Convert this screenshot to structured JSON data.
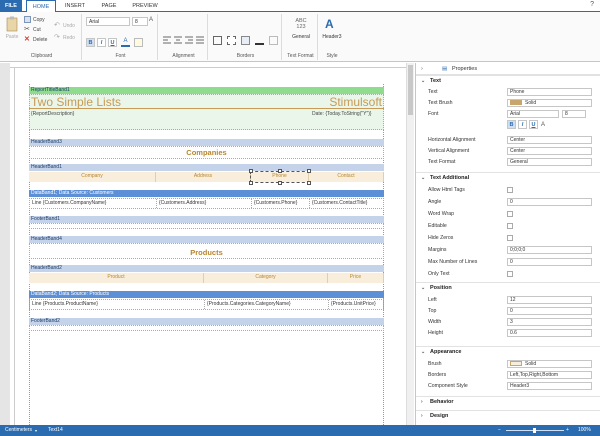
{
  "tabs": {
    "file": "FILE",
    "home": "HOME",
    "insert": "INSERT",
    "page": "PAGE",
    "preview": "PREVIEW",
    "help": "?"
  },
  "ribbon": {
    "clipboard": {
      "paste": "Paste",
      "copy": "Copy",
      "cut": "Cut",
      "delete": "Delete",
      "undo": "Undo",
      "redo": "Redo",
      "label": "Clipboard"
    },
    "font": {
      "name": "Arial",
      "size": "8",
      "label": "Font",
      "bold": "B",
      "italic": "I",
      "underline": "U"
    },
    "alignment": {
      "label": "Alignment"
    },
    "borders": {
      "label": "Borders"
    },
    "text_format": {
      "preview": "ABC\n123",
      "name": "General",
      "label": "Text Format"
    },
    "style": {
      "preview": "A",
      "name": "Header3",
      "label": "Style"
    }
  },
  "report": {
    "report_title_band": "ReportTitleBand1",
    "title": "Two Simple Lists",
    "brand": "Stimulsoft",
    "description": "{ReportDescription}",
    "date_expr": "Date: {Today.ToString(\"Y\")}",
    "header_band3": "HeaderBand3",
    "companies_title": "Companies",
    "header_band1": "HeaderBand1",
    "company_cols": [
      "Company",
      "Address",
      "Phone",
      "Contact"
    ],
    "data_band1": "DataBand1; Data Source: Customers",
    "company_cells": [
      "Line {Customers.CompanyName}",
      "{Customers.Address}",
      "{Customers.Phone}",
      "{Customers.ContactTitle}"
    ],
    "footer_band1": "FooterBand1",
    "header_band4": "HeaderBand4",
    "products_title": "Products",
    "header_band2": "HeaderBand2",
    "product_cols": [
      "Product",
      "Category",
      "Price"
    ],
    "data_band2": "DataBand2; Data Source: Products",
    "product_cells": [
      "Line {Products.ProductName}",
      "{Products.Categories.CategoryName}",
      "{Products.UnitPrice}"
    ],
    "footer_band2": "FooterBand2"
  },
  "properties": {
    "title": "Properties",
    "sections": {
      "text": "Text",
      "text_additional": "Text Additional",
      "position": "Position",
      "appearance": "Appearance",
      "behavior": "Behavior",
      "design": "Design"
    },
    "text_rows": [
      {
        "label": "Text",
        "value": "Phone"
      },
      {
        "label": "Text Brush",
        "value": "Solid"
      },
      {
        "label": "Font",
        "value": "Arial",
        "size": "8"
      },
      {
        "label": "",
        "value": ""
      },
      {
        "label": "Horizontal Alignment",
        "value": "Center"
      },
      {
        "label": "Vertical Alignment",
        "value": "Center"
      },
      {
        "label": "Text Format",
        "value": "General"
      }
    ],
    "additional_rows": [
      {
        "label": "Allow Html Tags"
      },
      {
        "label": "Angle",
        "value": "0"
      },
      {
        "label": "Word Wrap"
      },
      {
        "label": "Editable"
      },
      {
        "label": "Hide Zeros"
      },
      {
        "label": "Margins",
        "value": "0;0;0;0"
      },
      {
        "label": "Max Number of Lines",
        "value": "0"
      },
      {
        "label": "Only Text"
      }
    ],
    "position_rows": [
      {
        "label": "Left",
        "value": "12"
      },
      {
        "label": "Top",
        "value": "0"
      },
      {
        "label": "Width",
        "value": "3"
      },
      {
        "label": "Height",
        "value": "0.6"
      }
    ],
    "appearance_rows": [
      {
        "label": "Brush",
        "value": "Solid"
      },
      {
        "label": "Borders",
        "value": "Left,Top,Right,Bottom"
      },
      {
        "label": "Component Style",
        "value": "Header3"
      }
    ]
  },
  "status": {
    "units": "Centimeters",
    "component": "Text14",
    "zoom": "100%"
  }
}
